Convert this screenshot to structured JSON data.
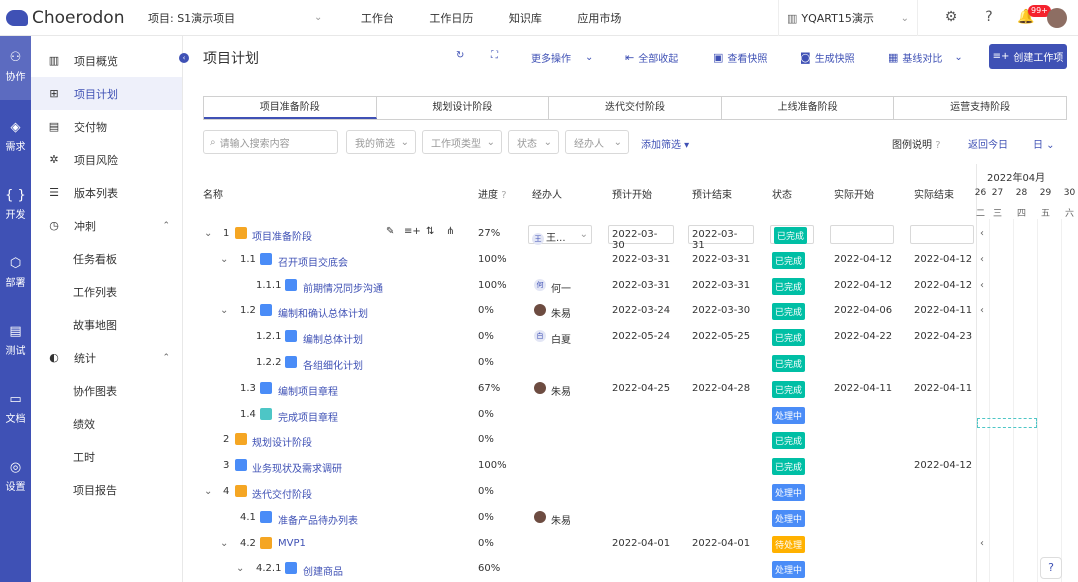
{
  "brand": "Choerodon",
  "project": "项目: S1演示项目",
  "topnav": [
    "工作台",
    "工作日历",
    "知识库",
    "应用市场"
  ],
  "org": "YQART15演示",
  "badge": "99+",
  "rail": [
    {
      "label": "协作"
    },
    {
      "label": "需求"
    },
    {
      "label": "开发"
    },
    {
      "label": "部署"
    },
    {
      "label": "测试"
    },
    {
      "label": "文档"
    },
    {
      "label": "设置"
    }
  ],
  "side": [
    "项目概览",
    "项目计划",
    "交付物",
    "项目风险",
    "版本列表",
    "冲刺",
    "任务看板",
    "工作列表",
    "故事地图",
    "统计",
    "协作图表",
    "绩效",
    "工时",
    "项目报告"
  ],
  "page_title": "项目计划",
  "toolbar": {
    "more": "更多操作",
    "collapse": "全部收起",
    "snapshot_view": "查看快照",
    "snapshot_gen": "生成快照",
    "baseline": "基线对比",
    "create": "创建工作项"
  },
  "phases": [
    "项目准备阶段",
    "规划设计阶段",
    "迭代交付阶段",
    "上线准备阶段",
    "运营支持阶段"
  ],
  "filters": {
    "search_ph": "请输入搜索内容",
    "mine": "我的筛选",
    "type": "工作项类型",
    "status": "状态",
    "assignee": "经办人",
    "add": "添加筛选",
    "legend": "图例说明",
    "today": "返回今日",
    "unit": "日"
  },
  "columns": [
    "名称",
    "进度",
    "经办人",
    "预计开始",
    "预计结束",
    "状态",
    "实际开始",
    "实际结束"
  ],
  "gantt": {
    "month": "2022年04月",
    "days": [
      "26",
      "27",
      "28",
      "29",
      "30"
    ],
    "weekdays": [
      "二",
      "三",
      "四",
      "五",
      "六"
    ]
  },
  "rows": [
    {
      "num": "1",
      "name": "项目准备阶段",
      "type": "stage",
      "progress": "27%",
      "assignee": "王...",
      "est_start": "2022-03-30",
      "est_end": "2022-03-31",
      "status": "已完成",
      "act_start": "",
      "act_end": ""
    },
    {
      "num": "1.1",
      "name": "召开项目交底会",
      "type": "task",
      "progress": "100%",
      "assignee": "",
      "est_start": "2022-03-31",
      "est_end": "2022-03-31",
      "status": "已完成",
      "act_start": "2022-04-12",
      "act_end": "2022-04-12"
    },
    {
      "num": "1.1.1",
      "name": "前期情况同步沟通",
      "type": "task",
      "progress": "100%",
      "assignee": "何一",
      "est_start": "2022-03-31",
      "est_end": "2022-03-31",
      "status": "已完成",
      "act_start": "2022-04-12",
      "act_end": "2022-04-12"
    },
    {
      "num": "1.2",
      "name": "编制和确认总体计划",
      "type": "task",
      "progress": "0%",
      "assignee": "朱易",
      "est_start": "2022-03-24",
      "est_end": "2022-03-30",
      "status": "已完成",
      "act_start": "2022-04-06",
      "act_end": "2022-04-11"
    },
    {
      "num": "1.2.1",
      "name": "编制总体计划",
      "type": "task",
      "progress": "0%",
      "assignee": "白夏",
      "est_start": "2022-05-24",
      "est_end": "2022-05-25",
      "status": "已完成",
      "act_start": "2022-04-22",
      "act_end": "2022-04-23"
    },
    {
      "num": "1.2.2",
      "name": "各组细化计划",
      "type": "task",
      "progress": "0%",
      "assignee": "",
      "est_start": "",
      "est_end": "",
      "status": "已完成",
      "act_start": "",
      "act_end": ""
    },
    {
      "num": "1.3",
      "name": "编制项目章程",
      "type": "task",
      "progress": "67%",
      "assignee": "朱易",
      "est_start": "2022-04-25",
      "est_end": "2022-04-28",
      "status": "已完成",
      "act_start": "2022-04-11",
      "act_end": "2022-04-11"
    },
    {
      "num": "1.4",
      "name": "完成项目章程",
      "type": "ms",
      "progress": "0%",
      "assignee": "",
      "est_start": "",
      "est_end": "",
      "status": "处理中",
      "act_start": "",
      "act_end": ""
    },
    {
      "num": "2",
      "name": "规划设计阶段",
      "type": "stage",
      "progress": "0%",
      "assignee": "",
      "est_start": "",
      "est_end": "",
      "status": "已完成",
      "act_start": "",
      "act_end": ""
    },
    {
      "num": "3",
      "name": "业务现状及需求调研",
      "type": "task",
      "progress": "100%",
      "assignee": "",
      "est_start": "",
      "est_end": "",
      "status": "已完成",
      "act_start": "",
      "act_end": "2022-04-12"
    },
    {
      "num": "4",
      "name": "迭代交付阶段",
      "type": "stage",
      "progress": "0%",
      "assignee": "",
      "est_start": "",
      "est_end": "",
      "status": "处理中",
      "act_start": "",
      "act_end": ""
    },
    {
      "num": "4.1",
      "name": "准备产品待办列表",
      "type": "task",
      "progress": "0%",
      "assignee": "朱易",
      "est_start": "",
      "est_end": "",
      "status": "处理中",
      "act_start": "",
      "act_end": ""
    },
    {
      "num": "4.2",
      "name": "MVP1",
      "type": "stage",
      "progress": "0%",
      "assignee": "",
      "est_start": "2022-04-01",
      "est_end": "2022-04-01",
      "status": "待处理",
      "act_start": "",
      "act_end": ""
    },
    {
      "num": "4.2.1",
      "name": "创建商品",
      "type": "task",
      "progress": "60%",
      "assignee": "",
      "est_start": "",
      "est_end": "",
      "status": "处理中",
      "act_start": "",
      "act_end": ""
    }
  ]
}
